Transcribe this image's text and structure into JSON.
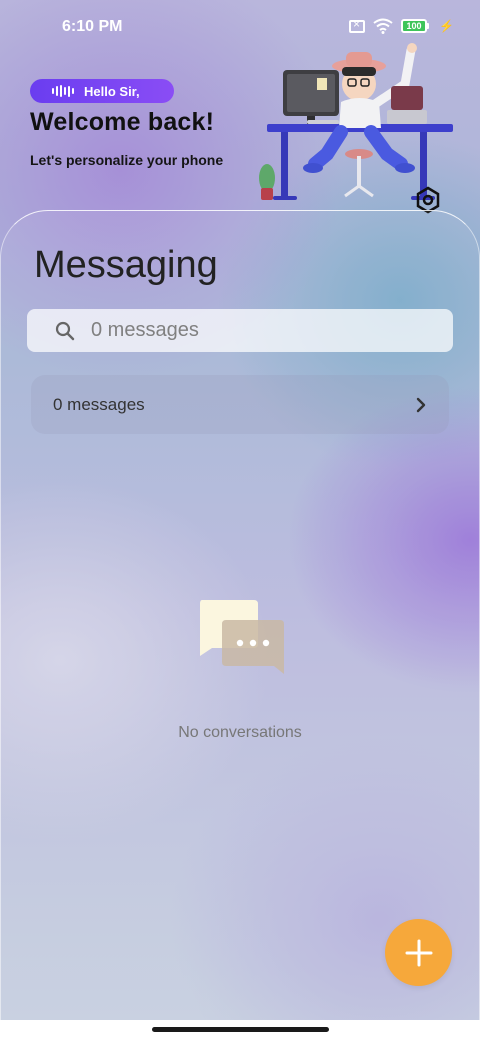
{
  "status_bar": {
    "time": "6:10 PM",
    "battery_level": "100",
    "icons": [
      "sim-off-icon",
      "wifi-icon",
      "battery-icon",
      "charging-bolt-icon"
    ]
  },
  "header": {
    "greeting": "Hello Sir,",
    "title": "Welcome back!",
    "subtitle": "Let's personalize your phone",
    "illustration": "person-at-desk-with-computer",
    "theme_icon": "hexagon-settings-icon"
  },
  "main": {
    "title": "Messaging",
    "search": {
      "placeholder": "0 messages"
    },
    "summary_row": {
      "label": "0 messages"
    },
    "empty_state": {
      "icon": "chat-bubbles-icon",
      "text": "No conversations"
    },
    "fab": {
      "icon": "plus-icon"
    }
  },
  "colors": {
    "accent": "#f6a83b",
    "pill": "#6a3df0",
    "battery": "#3ec55a"
  }
}
